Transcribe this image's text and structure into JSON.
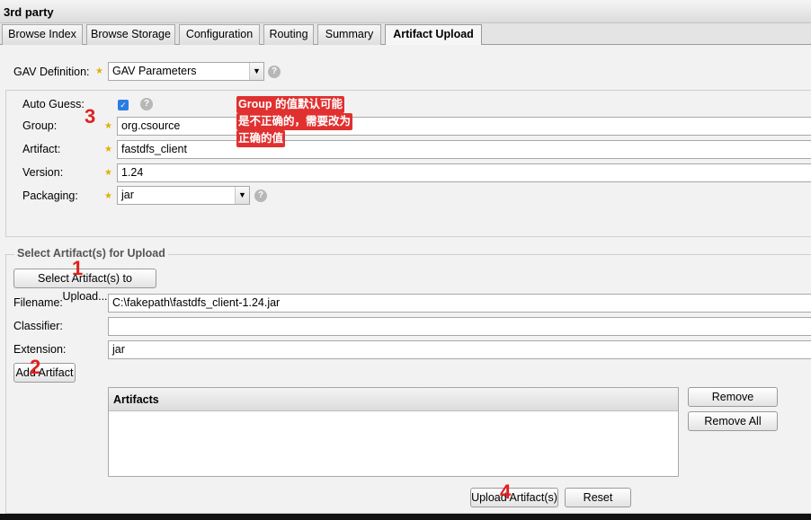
{
  "window": {
    "title": "3rd party"
  },
  "tabs": [
    {
      "label": "Browse Index"
    },
    {
      "label": "Browse Storage"
    },
    {
      "label": "Configuration"
    },
    {
      "label": "Routing"
    },
    {
      "label": "Summary"
    },
    {
      "label": "Artifact Upload",
      "active": true
    }
  ],
  "gav": {
    "definition_label": "GAV Definition:",
    "definition_value": "GAV Parameters",
    "auto_guess_label": "Auto Guess:",
    "auto_guess_checked": true,
    "group_label": "Group:",
    "group_value": "org.csource",
    "artifact_label": "Artifact:",
    "artifact_value": "fastdfs_client",
    "version_label": "Version:",
    "version_value": "1.24",
    "packaging_label": "Packaging:",
    "packaging_value": "jar"
  },
  "upload": {
    "legend": "Select Artifact(s) for Upload",
    "select_button": "Select Artifact(s) to Upload...",
    "filename_label": "Filename:",
    "filename_value": "C:\\fakepath\\fastdfs_client-1.24.jar",
    "classifier_label": "Classifier:",
    "classifier_value": "",
    "extension_label": "Extension:",
    "extension_value": "jar",
    "add_button": "Add Artifact",
    "artifacts_header": "Artifacts",
    "remove_button": "Remove",
    "remove_all_button": "Remove All",
    "upload_button": "Upload Artifact(s)",
    "reset_button": "Reset"
  },
  "annotations": {
    "badge1": "1",
    "badge2": "2",
    "badge3": "3",
    "badge4": "4",
    "note_line1": "Group 的值默认可能",
    "note_line2": "是不正确的，需要改为",
    "note_line3": "正确的值"
  },
  "icons": {
    "help": "help-icon",
    "required": "star-icon",
    "dropdown": "chevron-down-icon",
    "check": "checkmark-icon"
  },
  "colors": {
    "annotation_red": "#e02020",
    "checkbox_blue": "#2a7de1",
    "required_star": "#e0b000"
  }
}
